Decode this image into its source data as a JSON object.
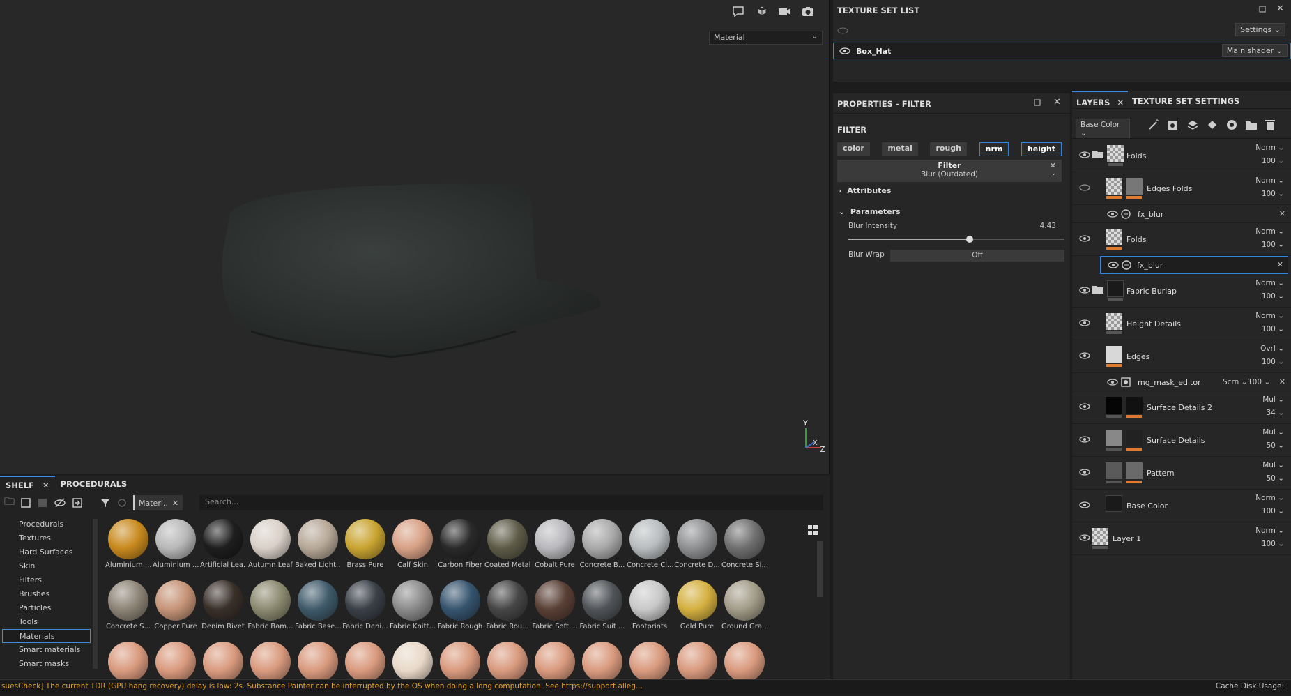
{
  "viewport": {
    "shading_dropdown": "Material",
    "axis_y": "Y",
    "axis_x": "X",
    "axis_z": "Z"
  },
  "shelf": {
    "tabs": [
      "SHELF",
      "PROCEDURALS"
    ],
    "filter_chip": "Materi..",
    "search_placeholder": "Search...",
    "categories": [
      "Procedurals",
      "Textures",
      "Hard Surfaces",
      "Skin",
      "Filters",
      "Brushes",
      "Particles",
      "Tools",
      "Materials",
      "Smart materials",
      "Smart masks"
    ],
    "selected_category": "Materials",
    "materials": [
      {
        "label": "Aluminium ...",
        "color": "#c98a1e"
      },
      {
        "label": "Aluminium ...",
        "color": "#b8b8b8"
      },
      {
        "label": "Artificial Lea...",
        "color": "#1e1e1e"
      },
      {
        "label": "Autumn Leaf",
        "color": "#d9d0c8"
      },
      {
        "label": "Baked Light...",
        "color": "#b7a898"
      },
      {
        "label": "Brass Pure",
        "color": "#c9a431"
      },
      {
        "label": "Calf Skin",
        "color": "#d8a186"
      },
      {
        "label": "Carbon Fiber",
        "color": "#2a2a2a"
      },
      {
        "label": "Coated Metal",
        "color": "#5e5c48"
      },
      {
        "label": "Cobalt Pure",
        "color": "#b9b9bd"
      },
      {
        "label": "Concrete B...",
        "color": "#a9a9a9"
      },
      {
        "label": "Concrete Cl...",
        "color": "#b8bcbe"
      },
      {
        "label": "Concrete D...",
        "color": "#8f9092"
      },
      {
        "label": "Concrete Si...",
        "color": "#6f6f70"
      },
      {
        "label": "Concrete S...",
        "color": "#8d8476"
      },
      {
        "label": "Copper Pure",
        "color": "#c69478"
      },
      {
        "label": "Denim Rivet",
        "color": "#3a302a"
      },
      {
        "label": "Fabric Bam...",
        "color": "#8c8a70"
      },
      {
        "label": "Fabric Base...",
        "color": "#3f5a6a"
      },
      {
        "label": "Fabric Deni...",
        "color": "#3a4048"
      },
      {
        "label": "Fabric Knitt...",
        "color": "#8a8a8a"
      },
      {
        "label": "Fabric Rough",
        "color": "#36546e"
      },
      {
        "label": "Fabric Rou...",
        "color": "#464646"
      },
      {
        "label": "Fabric Soft ...",
        "color": "#5a4036"
      },
      {
        "label": "Fabric Suit ...",
        "color": "#505458"
      },
      {
        "label": "Footprints",
        "color": "#c8c8c8"
      },
      {
        "label": "Gold Pure",
        "color": "#d4b040"
      },
      {
        "label": "Ground Gra...",
        "color": "#a29c88"
      },
      {
        "label": "",
        "color": "#d99a7e"
      },
      {
        "label": "",
        "color": "#d99a7e"
      },
      {
        "label": "",
        "color": "#d99a7e"
      },
      {
        "label": "",
        "color": "#d99a7e"
      },
      {
        "label": "",
        "color": "#d99a7e"
      },
      {
        "label": "",
        "color": "#d99a7e"
      },
      {
        "label": "",
        "color": "#e8d8c8"
      },
      {
        "label": "",
        "color": "#d99a7e"
      },
      {
        "label": "",
        "color": "#d99a7e"
      },
      {
        "label": "",
        "color": "#d99a7e"
      },
      {
        "label": "",
        "color": "#d99a7e"
      },
      {
        "label": "",
        "color": "#d99a7e"
      },
      {
        "label": "",
        "color": "#d99a7e"
      },
      {
        "label": "",
        "color": "#d99a7e"
      }
    ]
  },
  "status": {
    "message": "suesCheck] The current TDR (GPU hang recovery) delay is low: 2s. Substance Painter can be interrupted by the OS when doing a long computation. See https://support.alleg...",
    "cache": "Cache Disk Usage:"
  },
  "texture_set_list": {
    "title": "TEXTURE SET LIST",
    "settings": "Settings",
    "set_name": "Box_Hat",
    "shader": "Main shader"
  },
  "properties": {
    "title": "PROPERTIES - FILTER",
    "section": "FILTER",
    "channels": [
      "color",
      "metal",
      "rough",
      "nrm",
      "height"
    ],
    "active_channels": [
      "nrm",
      "height"
    ],
    "filter_label": "Filter",
    "filter_value": "Blur (Outdated)",
    "attributes": "Attributes",
    "parameters": "Parameters",
    "blur_intensity_label": "Blur Intensity",
    "blur_intensity_value": "4.43",
    "blur_intensity_fraction": 0.56,
    "blur_wrap_label": "Blur Wrap",
    "blur_wrap_value": "Off"
  },
  "layers": {
    "tabs": [
      "LAYERS",
      "TEXTURE SET SETTINGS"
    ],
    "channel_dropdown": "Base Color",
    "rows": [
      {
        "name": "Folds",
        "blend": "Norm",
        "opacity": "100"
      },
      {
        "name": "Edges Folds",
        "blend": "Norm",
        "opacity": "100"
      },
      {
        "name": "fx_blur"
      },
      {
        "name": "Folds",
        "blend": "Norm",
        "opacity": "100"
      },
      {
        "name": "fx_blur"
      },
      {
        "name": "Fabric Burlap",
        "blend": "Norm",
        "opacity": "100"
      },
      {
        "name": "Height Details",
        "blend": "Norm",
        "opacity": "100"
      },
      {
        "name": "Edges",
        "blend": "Ovrl",
        "opacity": "100"
      },
      {
        "name": "mg_mask_editor",
        "blend": "Scrn",
        "opacity": "100"
      },
      {
        "name": "Surface Details 2",
        "blend": "Mul",
        "opacity": "34"
      },
      {
        "name": "Surface Details",
        "blend": "Mul",
        "opacity": "50"
      },
      {
        "name": "Pattern",
        "blend": "Mul",
        "opacity": "50"
      },
      {
        "name": "Base Color",
        "blend": "Norm",
        "opacity": "100"
      },
      {
        "name": "Layer 1",
        "blend": "Norm",
        "opacity": "100"
      }
    ]
  }
}
